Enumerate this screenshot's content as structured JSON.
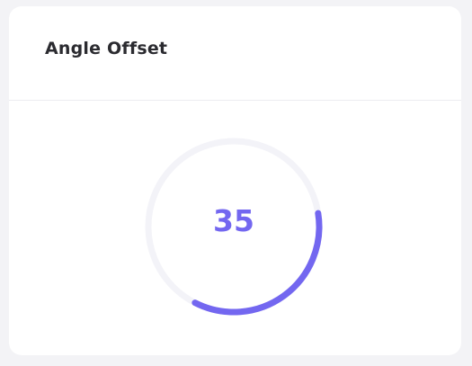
{
  "card": {
    "title": "Angle Offset"
  },
  "knob": {
    "value": "35",
    "progress_fraction": 0.35,
    "start_angle_deg": 90,
    "track_color": "#f3f3f8",
    "progress_color": "#7367f0",
    "value_color": "#7367f0"
  }
}
